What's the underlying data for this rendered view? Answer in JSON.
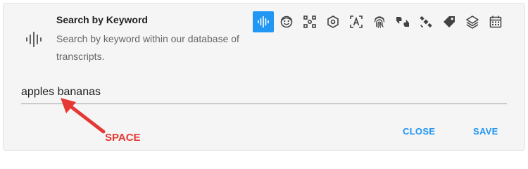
{
  "engine": {
    "title": "Search by Keyword",
    "description": "Search by keyword within our database of transcripts.",
    "icon": "waveform-icon"
  },
  "toolbar": {
    "tools": [
      {
        "icon": "waveform-icon",
        "active": true
      },
      {
        "icon": "face-icon",
        "active": false
      },
      {
        "icon": "object-detect-icon",
        "active": false
      },
      {
        "icon": "hexagon-icon",
        "active": false
      },
      {
        "icon": "text-recognition-icon",
        "active": false
      },
      {
        "icon": "fingerprint-icon",
        "active": false
      },
      {
        "icon": "thumbs-up-down-icon",
        "active": false
      },
      {
        "icon": "satellite-icon",
        "active": false
      },
      {
        "icon": "tag-icon",
        "active": false
      },
      {
        "icon": "layers-icon",
        "active": false
      },
      {
        "icon": "calendar-icon",
        "active": false
      }
    ],
    "active_color": "#2196f3",
    "icon_color": "#616161"
  },
  "search": {
    "value": "apples bananas"
  },
  "actions": {
    "close_label": "CLOSE",
    "save_label": "SAVE",
    "color": "#2196f3"
  },
  "annotation": {
    "label": "SPACE",
    "color": "#e53935"
  }
}
